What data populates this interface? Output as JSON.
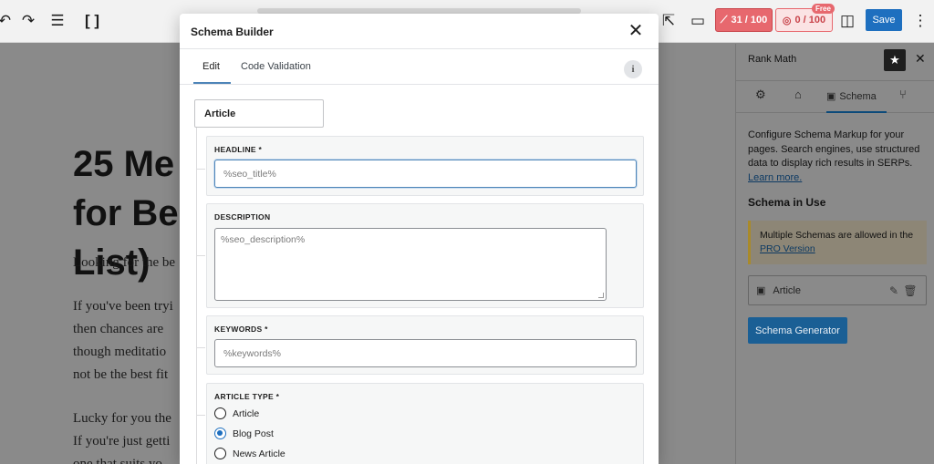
{
  "topbar": {
    "seo_score": "31 / 100",
    "content_score": "0 / 100",
    "free_badge": "Free",
    "save_label": "Save"
  },
  "post": {
    "title": "25 Me for Be List)",
    "paragraphs": [
      "Looking for the be",
      "If you've been tryi",
      "then chances are",
      "though meditatio",
      "not be the best fit",
      "Lucky for you the",
      "If you're just getti",
      "one that suits yo"
    ]
  },
  "sidebar": {
    "title": "Rank Math",
    "tab_schema": "Schema",
    "description": "Configure Schema Markup for your pages. Search engines, use structured data to display rich results in SERPs.",
    "learn_more": "Learn more.",
    "schema_in_use": "Schema in Use",
    "notice": "Multiple Schemas are allowed in the",
    "notice_link": "PRO Version",
    "schema_item": "Article",
    "generator_button": "Schema Generator"
  },
  "modal": {
    "title": "Schema Builder",
    "tabs": [
      "Edit",
      "Code Validation"
    ],
    "schema_type": "Article",
    "fields": {
      "headline_label": "HEADLINE *",
      "headline_value": "%seo_title%",
      "description_label": "DESCRIPTION",
      "description_value": "%seo_description%",
      "keywords_label": "KEYWORDS *",
      "keywords_value": "%keywords%",
      "article_type_label": "ARTICLE TYPE *",
      "article_type_options": [
        "Article",
        "Blog Post",
        "News Article"
      ],
      "article_type_selected": "Blog Post"
    }
  },
  "colors": {
    "primary": "#1e6fbf",
    "seo_score_bg": "#e7686e",
    "focus_border": "#4e85b8"
  }
}
